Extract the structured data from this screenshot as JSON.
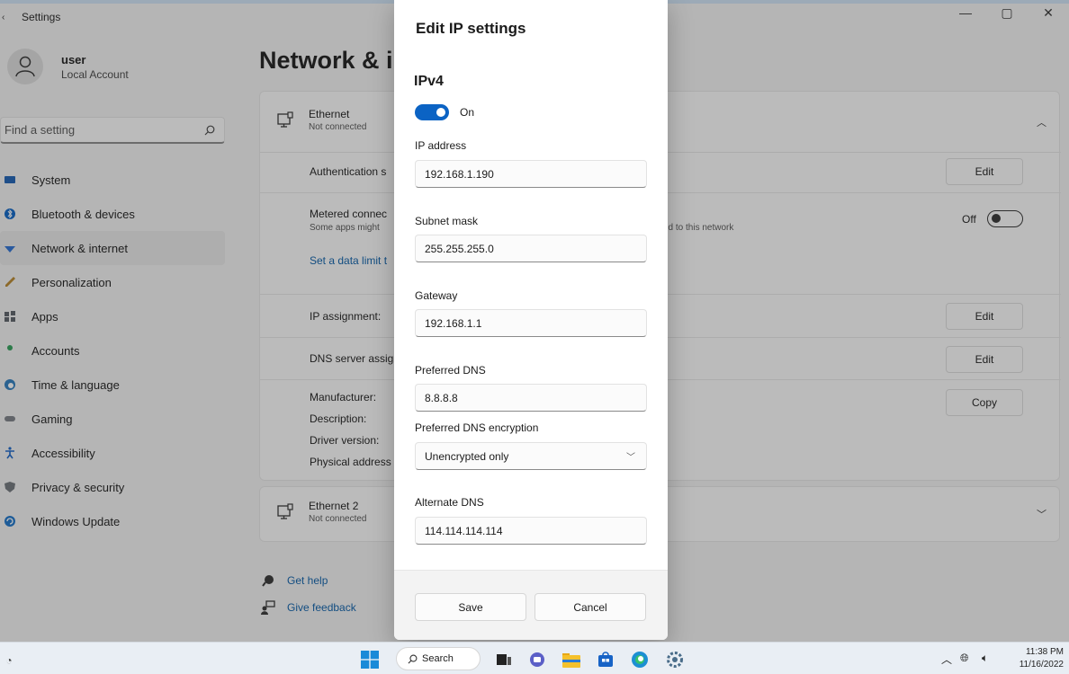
{
  "window": {
    "title": "Settings",
    "controls": [
      "—",
      "▢",
      "✕"
    ]
  },
  "profile": {
    "name": "user",
    "account_type": "Local Account"
  },
  "search": {
    "placeholder": "Find a setting"
  },
  "sidebar": {
    "items": [
      {
        "label": "System",
        "icon": "system-icon",
        "color": "#1a5fb4"
      },
      {
        "label": "Bluetooth & devices",
        "icon": "bluetooth-icon",
        "color": "#0b63c4"
      },
      {
        "label": "Network & internet",
        "icon": "wifi-icon",
        "color": "#2a6fd1",
        "active": true
      },
      {
        "label": "Personalization",
        "icon": "brush-icon",
        "color": "#b8862b"
      },
      {
        "label": "Apps",
        "icon": "apps-icon",
        "color": "#5a5f66"
      },
      {
        "label": "Accounts",
        "icon": "accounts-icon",
        "color": "#2e9e58"
      },
      {
        "label": "Time & language",
        "icon": "globe-clock-icon",
        "color": "#2b7bbd"
      },
      {
        "label": "Gaming",
        "icon": "controller-icon",
        "color": "#7a7f86"
      },
      {
        "label": "Accessibility",
        "icon": "accessibility-icon",
        "color": "#1763c6"
      },
      {
        "label": "Privacy & security",
        "icon": "shield-icon",
        "color": "#6f747a"
      },
      {
        "label": "Windows Update",
        "icon": "update-icon",
        "color": "#1a73c9"
      }
    ]
  },
  "main": {
    "page_title": "Network & i",
    "ethernet": {
      "title": "Ethernet",
      "status": "Not connected"
    },
    "rows": {
      "authentication": "Authentication s",
      "metered_label": "Metered connec",
      "metered_sub": "Some apps might",
      "metered_tail": "ed to this network",
      "metered_state": "Off",
      "data_limit_link": "Set a data limit t",
      "ip_assignment": "IP assignment:",
      "dns_assignment": "DNS server assig",
      "manufacturer": "Manufacturer:",
      "description": "Description:",
      "driver_version": "Driver version:",
      "physical_address": "Physical address"
    },
    "buttons": {
      "edit": "Edit",
      "copy": "Copy"
    },
    "ethernet2": {
      "title": "Ethernet 2",
      "status": "Not connected"
    },
    "help": {
      "get_help": "Get help",
      "give_feedback": "Give feedback"
    }
  },
  "dialog": {
    "title": "Edit IP settings",
    "section": "IPv4",
    "ipv4_toggle": "On",
    "ip_address_label": "IP address",
    "ip_address": "192.168.1.190",
    "subnet_label": "Subnet mask",
    "subnet": "255.255.255.0",
    "gateway_label": "Gateway",
    "gateway": "192.168.1.1",
    "pref_dns_label": "Preferred DNS",
    "pref_dns": "8.8.8.8",
    "pref_dns_enc_label": "Preferred DNS encryption",
    "pref_dns_enc": "Unencrypted only",
    "alt_dns_label": "Alternate DNS",
    "alt_dns": "114.114.114.114",
    "save": "Save",
    "cancel": "Cancel"
  },
  "taskbar": {
    "search": "Search",
    "time": "11:38 PM",
    "date": "11/16/2022"
  },
  "colors": {
    "accent": "#0b63c4",
    "link": "#0a5ea8"
  }
}
